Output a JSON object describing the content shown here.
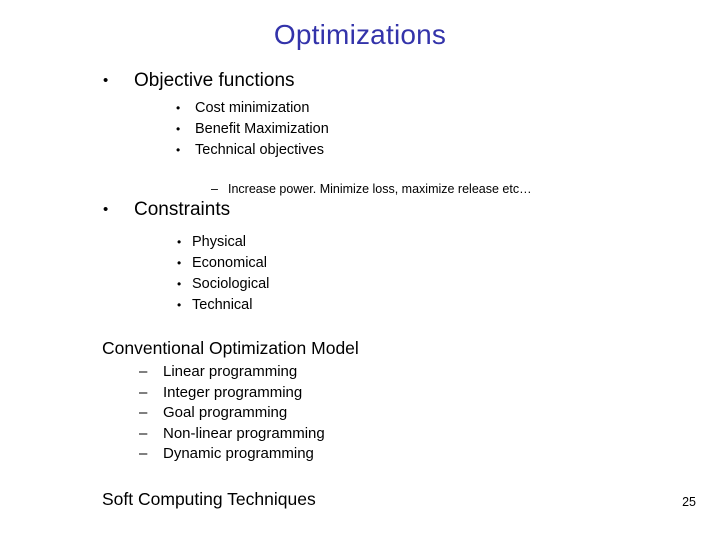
{
  "slide": {
    "title": "Optimizations",
    "title_color": "#3333AA",
    "background_color": "#FFFFFF",
    "page_number": "25"
  },
  "markers": {
    "bullet": "•",
    "dash": "–"
  },
  "sections": {
    "objective": {
      "heading": "Objective functions",
      "items": [
        {
          "label": "Cost minimization"
        },
        {
          "label": "Benefit Maximization"
        },
        {
          "label": "Technical objectives"
        }
      ],
      "detail": "Increase power. Minimize loss, maximize release etc…"
    },
    "constraints": {
      "heading": "Constraints",
      "items": [
        {
          "label": "Physical"
        },
        {
          "label": "Economical"
        },
        {
          "label": "Sociological"
        },
        {
          "label": "Technical"
        }
      ]
    },
    "conventional": {
      "heading": "Conventional Optimization Model",
      "items": [
        {
          "label": "Linear programming"
        },
        {
          "label": "Integer programming"
        },
        {
          "label": "Goal programming"
        },
        {
          "label": "Non-linear programming"
        },
        {
          "label": "Dynamic programming"
        }
      ]
    },
    "soft_computing": {
      "heading": "Soft Computing Techniques"
    }
  }
}
